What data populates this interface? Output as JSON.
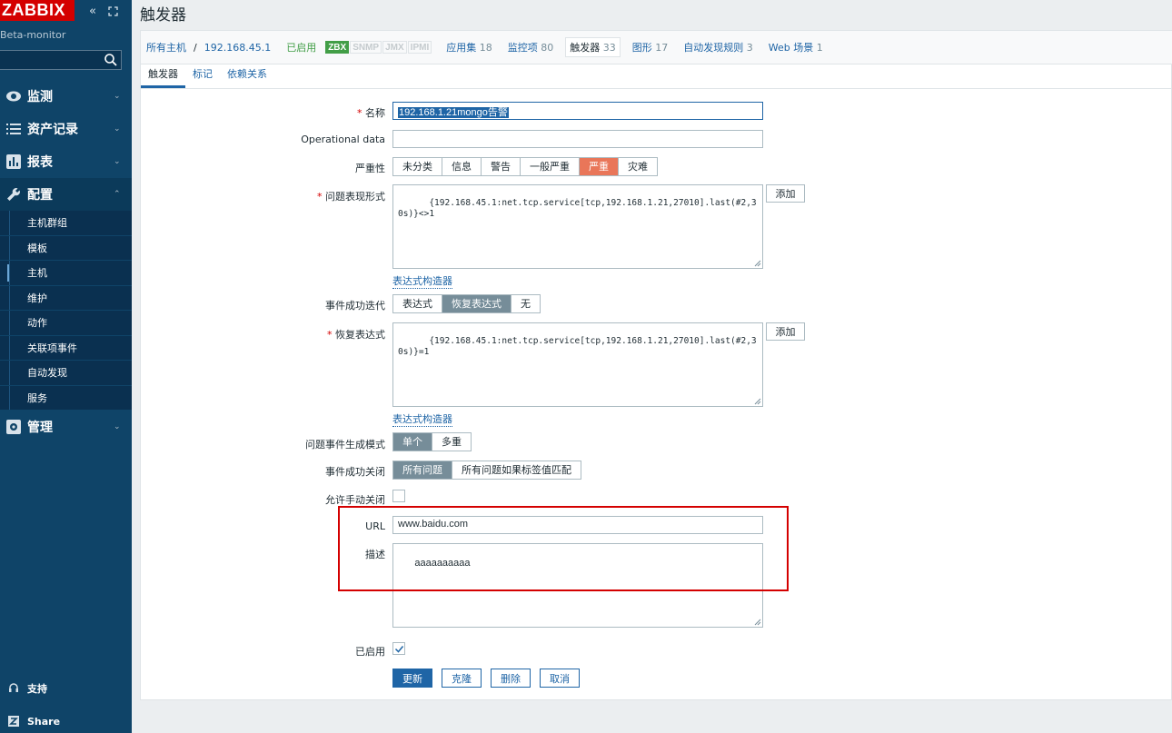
{
  "sidebar": {
    "logo": "ZABBIX",
    "server_name": "Beta-monitor",
    "menu": [
      {
        "label": "监测",
        "icon": "eye-icon"
      },
      {
        "label": "资产记录",
        "icon": "list-icon"
      },
      {
        "label": "报表",
        "icon": "bar-chart-icon"
      },
      {
        "label": "配置",
        "icon": "wrench-icon"
      }
    ],
    "submenu": [
      "主机群组",
      "模板",
      "主机",
      "维护",
      "动作",
      "关联项事件",
      "自动发现",
      "服务"
    ],
    "admin": "管理",
    "support": "支持",
    "share": "Share"
  },
  "page": {
    "title": "触发器"
  },
  "breadcrumbs": {
    "all_hosts": "所有主机",
    "host": "192.168.45.1",
    "enabled": "已启用",
    "availability": [
      "ZBX",
      "SNMP",
      "JMX",
      "IPMI"
    ],
    "applications": "应用集",
    "applications_count": "18",
    "items": "监控项",
    "items_count": "80",
    "triggers": "触发器",
    "triggers_count": "33",
    "graphs": "图形",
    "graphs_count": "17",
    "discovery": "自动发现规则",
    "discovery_count": "3",
    "web": "Web 场景",
    "web_count": "1"
  },
  "tabs": [
    "触发器",
    "标记",
    "依赖关系"
  ],
  "form": {
    "name_label": "名称",
    "name_value": "192.168.1.21mongo告警",
    "opdata_label": "Operational data",
    "severity_label": "严重性",
    "severities": [
      "未分类",
      "信息",
      "警告",
      "一般严重",
      "严重",
      "灾难"
    ],
    "problem_expr_label": "问题表现形式",
    "problem_expr": "{192.168.45.1:net.tcp.service[tcp,192.168.1.21,27010].last(#2,30s)}<>1",
    "add_label": "添加",
    "expr_builder": "表达式构造器",
    "ok_event_label": "事件成功迭代",
    "ok_event_options": [
      "表达式",
      "恢复表达式",
      "无"
    ],
    "recovery_expr_label": "恢复表达式",
    "recovery_expr": "{192.168.45.1:net.tcp.service[tcp,192.168.1.21,27010].last(#2,30s)}=1",
    "gen_mode_label": "问题事件生成模式",
    "gen_mode_options": [
      "单个",
      "多重"
    ],
    "ok_close_label": "事件成功关闭",
    "ok_close_options": [
      "所有问题",
      "所有问题如果标签值匹配"
    ],
    "manual_close_label": "允许手动关闭",
    "url_label": "URL",
    "url_value": "www.baidu.com",
    "desc_label": "描述",
    "desc_value": "aaaaaaaaaa",
    "enabled_label": "已启用"
  },
  "actions": {
    "update": "更新",
    "clone": "克隆",
    "delete": "删除",
    "cancel": "取消"
  }
}
